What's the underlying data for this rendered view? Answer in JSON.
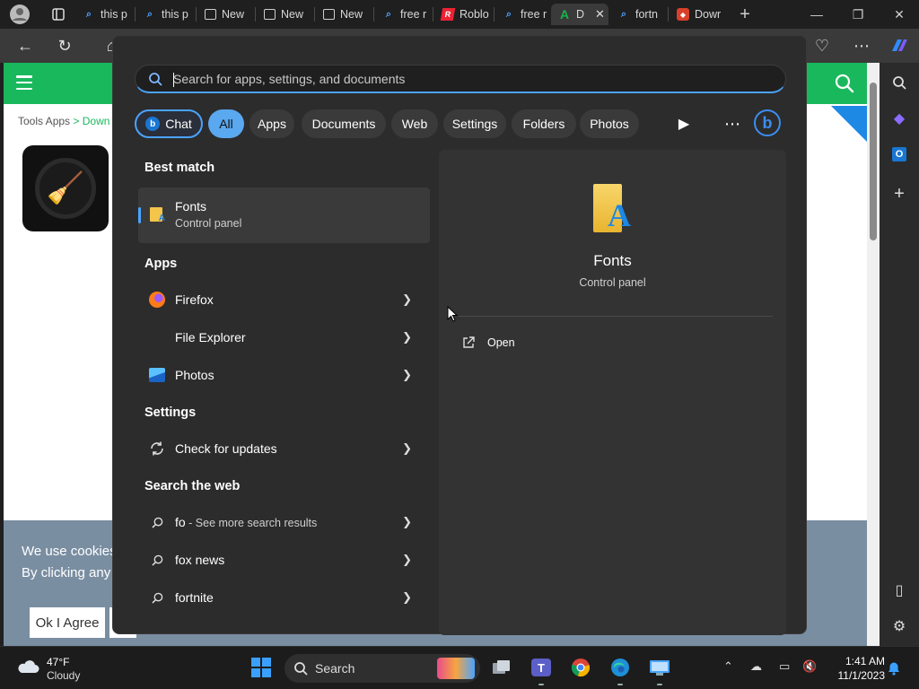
{
  "browser": {
    "tabs": [
      {
        "label": "this p",
        "icon": "search-icon"
      },
      {
        "label": "this p",
        "icon": "search-icon"
      },
      {
        "label": "New",
        "icon": "page-icon"
      },
      {
        "label": "New",
        "icon": "page-icon"
      },
      {
        "label": "New",
        "icon": "page-icon"
      },
      {
        "label": "free r",
        "icon": "search-icon"
      },
      {
        "label": "Roblo",
        "icon": "roblox-icon"
      },
      {
        "label": "free r",
        "icon": "search-icon"
      },
      {
        "label": "D",
        "icon": "site-a-icon",
        "active": true
      },
      {
        "label": "fortn",
        "icon": "search-icon"
      },
      {
        "label": "Dowr",
        "icon": "shield-icon"
      }
    ],
    "new_tab_glyph": "+",
    "window_controls": [
      "minimize",
      "restore",
      "close"
    ]
  },
  "website": {
    "breadcrumb_home": "Tools Apps",
    "breadcrumb_sep": ">",
    "breadcrumb_current": "Down",
    "cookie_line1": "We use cookies",
    "cookie_line2": "By clicking any li",
    "cookie_agree": "Ok I Agree",
    "accent_color": "#19b85c"
  },
  "search": {
    "placeholder": "Search for apps, settings, and documents",
    "filters": [
      "Chat",
      "All",
      "Apps",
      "Documents",
      "Web",
      "Settings",
      "Folders",
      "Photos"
    ],
    "active_filter": "All",
    "best_match_heading": "Best match",
    "best_match": {
      "title": "Fonts",
      "subtitle": "Control panel"
    },
    "apps_heading": "Apps",
    "apps": [
      "Firefox",
      "File Explorer",
      "Photos"
    ],
    "settings_heading": "Settings",
    "settings": [
      "Check for updates"
    ],
    "web_heading": "Search the web",
    "web": [
      {
        "query": "fo",
        "suffix": " - See more search results"
      },
      {
        "query": "fox news",
        "suffix": ""
      },
      {
        "query": "fortnite",
        "suffix": ""
      }
    ],
    "preview": {
      "title": "Fonts",
      "subtitle": "Control panel",
      "action_open": "Open"
    }
  },
  "taskbar": {
    "temperature": "47°F",
    "condition": "Cloudy",
    "search_label": "Search",
    "time": "1:41 AM",
    "date": "11/1/2023"
  }
}
